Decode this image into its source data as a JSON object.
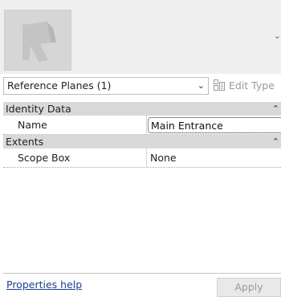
{
  "type_selector": {
    "selected": "Reference Planes (1)",
    "edit_type_label": "Edit Type"
  },
  "categories": [
    {
      "label": "Identity Data",
      "properties": [
        {
          "name": "Name",
          "value": "Main Entrance",
          "editing": true
        }
      ]
    },
    {
      "label": "Extents",
      "properties": [
        {
          "name": "Scope Box",
          "value": "None",
          "editing": false
        }
      ]
    }
  ],
  "footer": {
    "help_link": "Properties help",
    "apply_label": "Apply"
  }
}
